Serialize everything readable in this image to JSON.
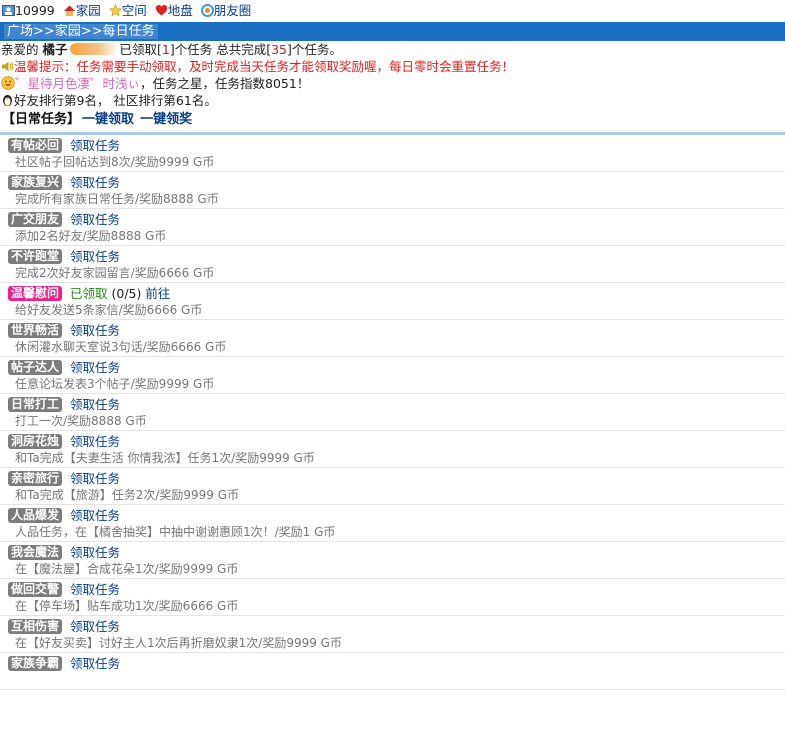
{
  "topnav": {
    "items": [
      {
        "icon": "user-id-icon",
        "label": "10999"
      },
      {
        "icon": "home-icon",
        "label": "家园"
      },
      {
        "icon": "star-icon",
        "label": "空间"
      },
      {
        "icon": "heart-icon",
        "label": "地盘"
      },
      {
        "icon": "friends-circle-icon",
        "label": "朋友圈"
      }
    ]
  },
  "breadcrumb": "广场>>家园>>每日任务",
  "greeting": {
    "prefix": "亲爱的",
    "name": "橘子",
    "received_prefix": "已领取[",
    "received_count": "1",
    "received_suffix": "]个任务 总共完成[",
    "completed_count": "35",
    "completed_suffix": "]个任务。"
  },
  "notice": {
    "icon": "speaker-icon",
    "text": "温馨提示：任务需要手动领取，及时完成当天任务才能领取奖励喔，每日零时会重置任务！"
  },
  "star_line": {
    "icon": "smile-icon",
    "nickname": "゛星待月色凄゜时浅ぃ",
    "text": "，任务之星，任务指数8051！"
  },
  "rank_line": {
    "icon": "penguin-icon",
    "text": "好友排行第9名， 社区排行第61名。"
  },
  "section": {
    "tag": "【日常任务】",
    "claim_all": "一键领取",
    "reward_all": "一键领奖"
  },
  "tasks": [
    {
      "name": "有帖必回",
      "action": "领取任务",
      "desc": "社区帖子回帖达到8次/奖励9999 G币"
    },
    {
      "name": "家族复兴",
      "action": "领取任务",
      "desc": "完成所有家族日常任务/奖励8888 G币"
    },
    {
      "name": "广交朋友",
      "action": "领取任务",
      "desc": "添加2名好友/奖励8888 G币"
    },
    {
      "name": "不许跑堂",
      "action": "领取任务",
      "desc": "完成2次好友家园留言/奖励6666 G币"
    },
    {
      "name": "温馨慰问",
      "status": "已领取",
      "progress": "(0/5)",
      "action": "前往",
      "desc": "给好友发送5条家信/奖励6666 G币",
      "active": true
    },
    {
      "name": "世界畅活",
      "action": "领取任务",
      "desc": "休闲灌水聊天室说3句话/奖励6666 G币"
    },
    {
      "name": "帖子达人",
      "action": "领取任务",
      "desc": "任意论坛发表3个帖子/奖励9999 G币"
    },
    {
      "name": "日常打工",
      "action": "领取任务",
      "desc": "打工一次/奖励8888 G币"
    },
    {
      "name": "洞房花烛",
      "action": "领取任务",
      "desc": "和Ta完成【夫妻生活 你情我浓】任务1次/奖励9999 G币"
    },
    {
      "name": "亲密旅行",
      "action": "领取任务",
      "desc": "和Ta完成【旅游】任务2次/奖励9999 G币"
    },
    {
      "name": "人品爆发",
      "action": "领取任务",
      "desc": "人品任务，在【橘舍抽奖】中抽中谢谢惠顾1次！/奖励1 G币"
    },
    {
      "name": "我会魔法",
      "action": "领取任务",
      "desc": "在【魔法屋】合成花朵1次/奖励9999 G币"
    },
    {
      "name": "做回交警",
      "action": "领取任务",
      "desc": "在【停车场】贴车成功1次/奖励6666 G币"
    },
    {
      "name": "互相伤害",
      "action": "领取任务",
      "desc": "在【好友买卖】讨好主人1次后再折磨奴隶1次/奖励9999 G币"
    },
    {
      "name": "家族争霸",
      "action": "领取任务",
      "desc": ""
    }
  ],
  "colors": {
    "header_bg": "#1a6fc0",
    "link": "#0b3f8c",
    "badge": "#7d7d7d",
    "badge_active": "#e8228a",
    "notice": "#e02020",
    "status_green": "#2a8a1a"
  }
}
